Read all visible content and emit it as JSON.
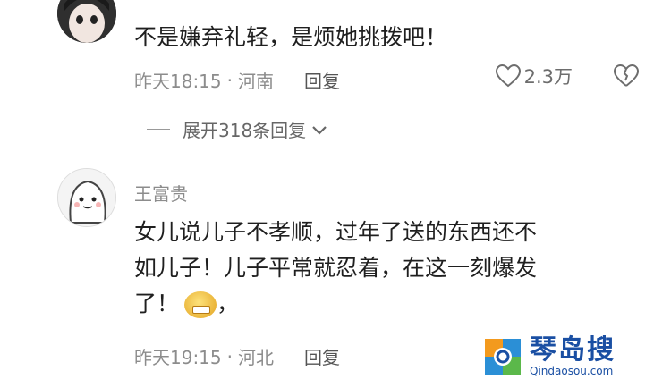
{
  "comments": [
    {
      "username": "",
      "text": "不是嫌弃礼轻，是烦她挑拨吧！",
      "time": "昨天18:15",
      "location": "河南",
      "reply_label": "回复",
      "likes": "2.3万",
      "avatar_icon": "avatar-dark-girl",
      "like_icon": "heart-outline-icon",
      "dislike_icon": "broken-heart-icon"
    },
    {
      "username": "王富贵",
      "text_lines": [
        "女儿说儿子不孝顺，过年了送的东西还不",
        "如儿子！儿子平常就忍着，在这一刻爆发",
        "了！"
      ],
      "text_tail": "，",
      "emoji": "grin-emoji",
      "time": "昨天19:15",
      "location": "河北",
      "reply_label": "回复",
      "avatar_icon": "avatar-cartoon-blob"
    }
  ],
  "expand_replies": {
    "label": "展开318条回复",
    "icon": "chevron-down-icon"
  },
  "separator": "·",
  "watermark": {
    "title": "琴岛搜",
    "subtitle": "Qindaosou.com"
  }
}
